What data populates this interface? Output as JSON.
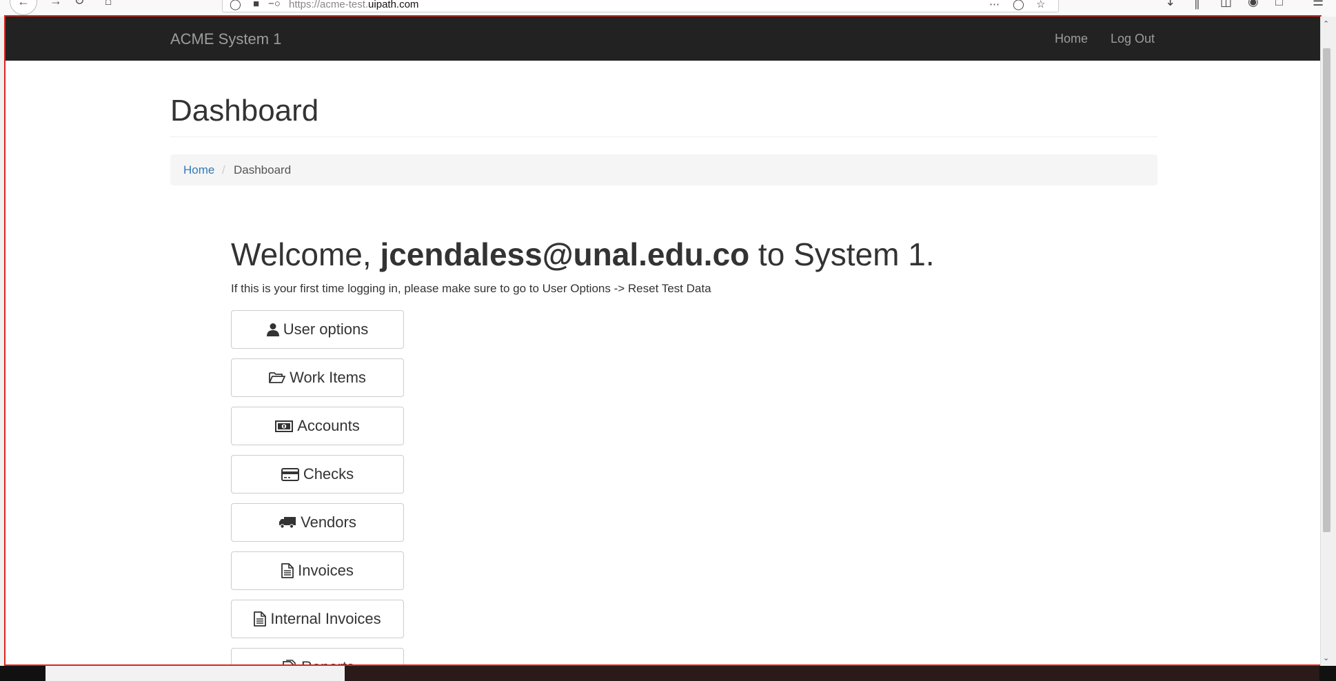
{
  "browser": {
    "url_prefix": "https://acme-test.",
    "url_host": "uipath.com"
  },
  "navbar": {
    "brand": "ACME System 1",
    "links": [
      {
        "label": "Home"
      },
      {
        "label": "Log Out"
      }
    ]
  },
  "page": {
    "title": "Dashboard",
    "breadcrumb": {
      "home": "Home",
      "separator": "/",
      "current": "Dashboard"
    },
    "welcome": {
      "prefix": "Welcome,",
      "user": "jcendaless@unal.edu.co",
      "suffix": "to System 1."
    },
    "hint": "If this is your first time logging in, please make sure to go to User Options -> Reset Test Data"
  },
  "menu": [
    {
      "label": "User options",
      "icon": "user-icon"
    },
    {
      "label": "Work Items",
      "icon": "folder-open-icon"
    },
    {
      "label": "Accounts",
      "icon": "money-icon"
    },
    {
      "label": "Checks",
      "icon": "credit-card-icon"
    },
    {
      "label": "Vendors",
      "icon": "truck-icon"
    },
    {
      "label": "Invoices",
      "icon": "file-text-icon"
    },
    {
      "label": "Internal Invoices",
      "icon": "file-text-icon"
    },
    {
      "label": "Reports",
      "icon": "report-icon"
    }
  ]
}
